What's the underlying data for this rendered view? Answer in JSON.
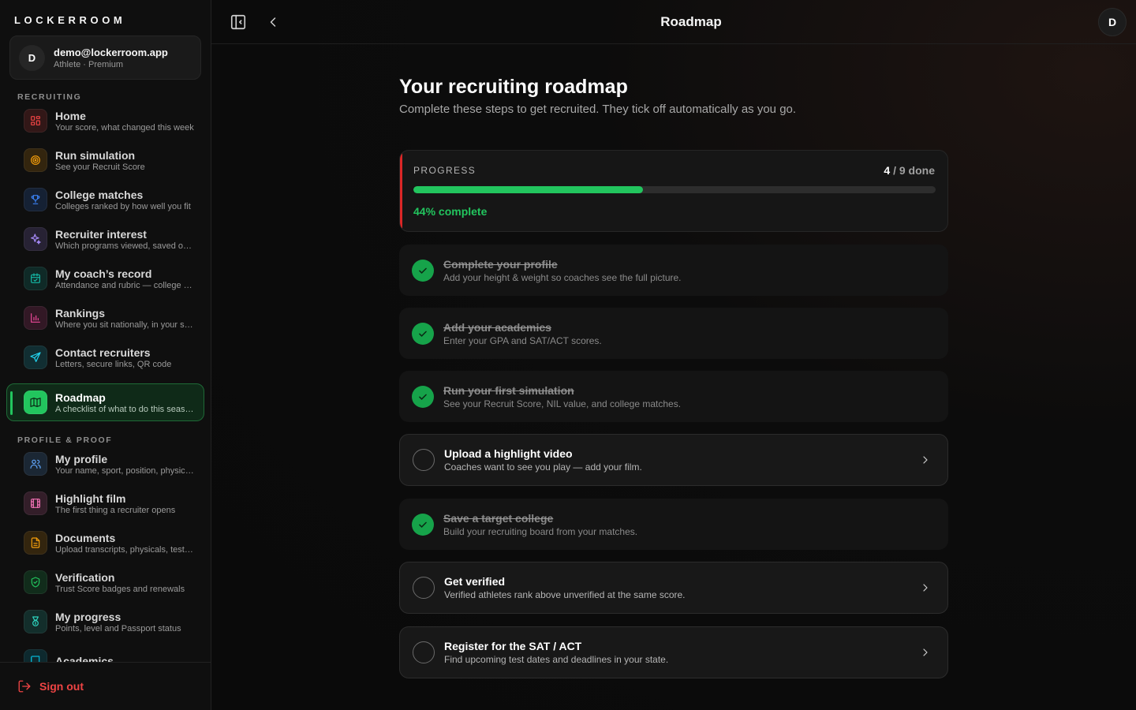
{
  "sidebar": {
    "brand": "LOCKERROOM",
    "account": {
      "avatar": "D",
      "email": "demo@lockerroom.app",
      "role": "Athlete · Premium"
    },
    "section_recruiting": "RECRUITING",
    "section_profile": "PROFILE & PROOF",
    "items": [
      {
        "title": "Home",
        "sub": "Your score, what changed this week",
        "icon": "grid-icon",
        "color": "#ef4444"
      },
      {
        "title": "Run simulation",
        "sub": "See your Recruit Score",
        "icon": "target-icon",
        "color": "#f59e0b"
      },
      {
        "title": "College matches",
        "sub": "Colleges ranked by how well you fit",
        "icon": "trophy-icon",
        "color": "#3b82f6"
      },
      {
        "title": "Recruiter interest",
        "sub": "Which programs viewed, saved or messaged",
        "icon": "sparkle-icon",
        "color": "#a78bfa"
      },
      {
        "title": "My coach’s record",
        "sub": "Attendance and rubric — college coaches see it",
        "icon": "calendar-check-icon",
        "color": "#14b8a6"
      },
      {
        "title": "Rankings",
        "sub": "Where you sit nationally, in your state",
        "icon": "bar-chart-icon",
        "color": "#ec4899"
      },
      {
        "title": "Contact recruiters",
        "sub": "Letters, secure links, QR code",
        "icon": "send-icon",
        "color": "#22d3ee"
      },
      {
        "title": "Roadmap",
        "sub": "A checklist of what to do this season",
        "icon": "map-icon",
        "color": "#22c55e"
      },
      {
        "title": "My profile",
        "sub": "Your name, sport, position, physicals",
        "icon": "users-icon",
        "color": "#60a5fa"
      },
      {
        "title": "Highlight film",
        "sub": "The first thing a recruiter opens",
        "icon": "film-icon",
        "color": "#f472b6"
      },
      {
        "title": "Documents",
        "sub": "Upload transcripts, physicals, test scores",
        "icon": "document-icon",
        "color": "#f59e0b"
      },
      {
        "title": "Verification",
        "sub": "Trust Score badges and renewals",
        "icon": "shield-check-icon",
        "color": "#22c55e"
      },
      {
        "title": "My progress",
        "sub": "Points, level and Passport status",
        "icon": "medal-icon",
        "color": "#2dd4bf"
      },
      {
        "title": "Academics",
        "sub": "",
        "icon": "book-icon",
        "color": "#06b6d4"
      }
    ],
    "signout": "Sign out"
  },
  "topbar": {
    "title": "Roadmap",
    "avatar": "D"
  },
  "main": {
    "heading": "Your recruiting roadmap",
    "subheading": "Complete these steps to get recruited. They tick off automatically as you go.",
    "progress": {
      "label": "PROGRESS",
      "done": "4",
      "total_text": " / 9 done",
      "fraction": 0.44,
      "pct_text": "44% complete"
    },
    "steps": [
      {
        "title": "Complete your profile",
        "desc": "Add your height & weight so coaches see the full picture.",
        "done": true
      },
      {
        "title": "Add your academics",
        "desc": "Enter your GPA and SAT/ACT scores.",
        "done": true
      },
      {
        "title": "Run your first simulation",
        "desc": "See your Recruit Score, NIL value, and college matches.",
        "done": true
      },
      {
        "title": "Upload a highlight video",
        "desc": "Coaches want to see you play — add your film.",
        "done": false
      },
      {
        "title": "Save a target college",
        "desc": "Build your recruiting board from your matches.",
        "done": true
      },
      {
        "title": "Get verified",
        "desc": "Verified athletes rank above unverified at the same score.",
        "done": false
      },
      {
        "title": "Register for the SAT / ACT",
        "desc": "Find upcoming test dates and deadlines in your state.",
        "done": false
      }
    ]
  }
}
